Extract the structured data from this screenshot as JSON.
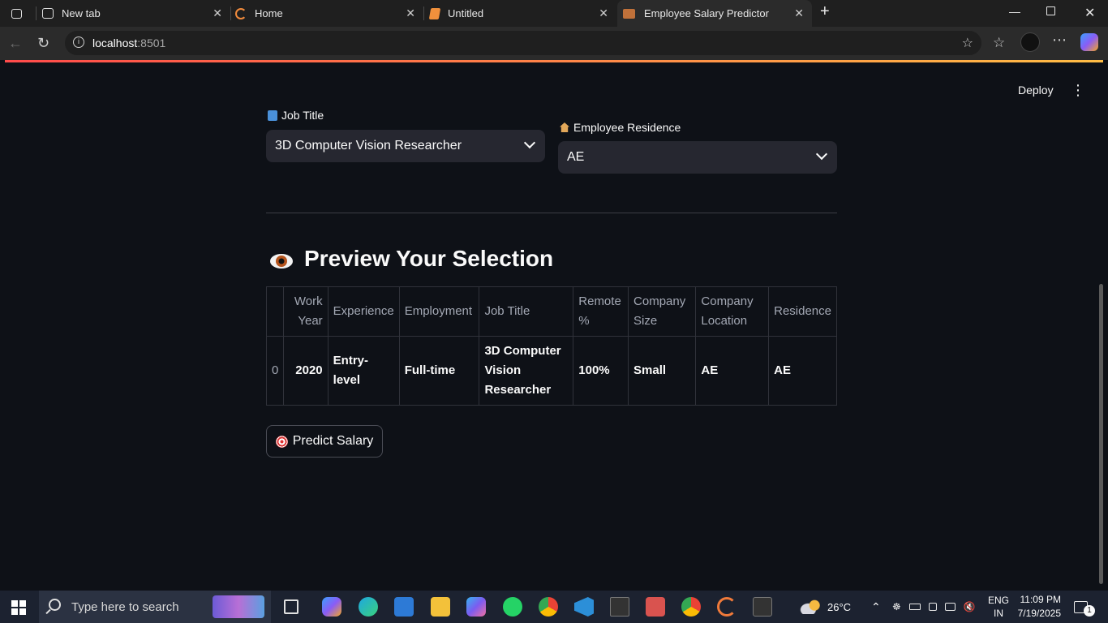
{
  "browser": {
    "tabs": [
      {
        "label": "New tab"
      },
      {
        "label": "Home"
      },
      {
        "label": "Untitled"
      },
      {
        "label": "Employee Salary Predictor"
      }
    ],
    "url_host": "localhost",
    "url_port": ":8501"
  },
  "app": {
    "deploy_label": "Deploy",
    "job_title": {
      "label": "Job Title",
      "value": "3D Computer Vision Researcher"
    },
    "residence": {
      "label": "Employee Residence",
      "value": "AE"
    },
    "preview_heading": "Preview Your Selection",
    "table": {
      "headers": [
        "",
        "Work Year",
        "Experience",
        "Employment",
        "Job Title",
        "Remote %",
        "Company Size",
        "Company Location",
        "Residence"
      ],
      "rows": [
        [
          "0",
          "2020",
          "Entry-level",
          "Full-time",
          "3D Computer Vision Researcher",
          "100%",
          "Small",
          "AE",
          "AE"
        ]
      ]
    },
    "predict_label": "Predict Salary"
  },
  "taskbar": {
    "search_placeholder": "Type here to search",
    "weather": "26°C",
    "lang_line1": "ENG",
    "lang_line2": "IN",
    "time": "11:09 PM",
    "date": "7/19/2025",
    "notification_count": "1"
  }
}
